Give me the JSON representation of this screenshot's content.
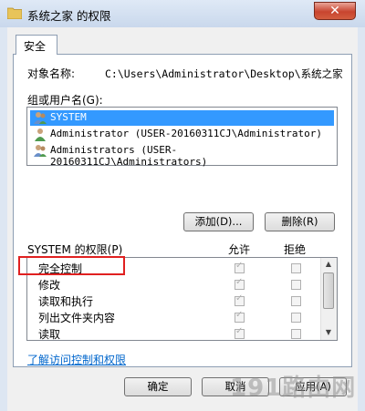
{
  "window": {
    "title": "系统之家 的权限",
    "close_glyph": "✕"
  },
  "tabs": [
    {
      "label": "安全"
    }
  ],
  "object": {
    "label": "对象名称:",
    "value": "C:\\Users\\Administrator\\Desktop\\系统之家"
  },
  "groups": {
    "label": "组或用户名(G):",
    "items": [
      {
        "name": "SYSTEM",
        "icon": "users-group-icon",
        "selected": true
      },
      {
        "name": "Administrator (USER-20160311CJ\\Administrator)",
        "icon": "user-icon",
        "selected": false
      },
      {
        "name": "Administrators (USER-20160311CJ\\Administrators)",
        "icon": "users-group-icon",
        "selected": false
      }
    ]
  },
  "buttons": {
    "add": "添加(D)...",
    "remove": "删除(R)",
    "ok": "确定",
    "cancel": "取消",
    "apply": "应用(A)"
  },
  "permissions": {
    "title": "SYSTEM 的权限(P)",
    "allow_header": "允许",
    "deny_header": "拒绝",
    "rows": [
      {
        "label": "完全控制",
        "allow": true,
        "deny": false
      },
      {
        "label": "修改",
        "allow": true,
        "deny": false
      },
      {
        "label": "读取和执行",
        "allow": true,
        "deny": false
      },
      {
        "label": "列出文件夹内容",
        "allow": true,
        "deny": false
      },
      {
        "label": "读取",
        "allow": true,
        "deny": false
      }
    ]
  },
  "help_link": "了解访问控制和权限",
  "watermark": "191路由网",
  "colors": {
    "selection": "#3399ff",
    "highlight_box": "#e02020",
    "link": "#0066cc"
  }
}
